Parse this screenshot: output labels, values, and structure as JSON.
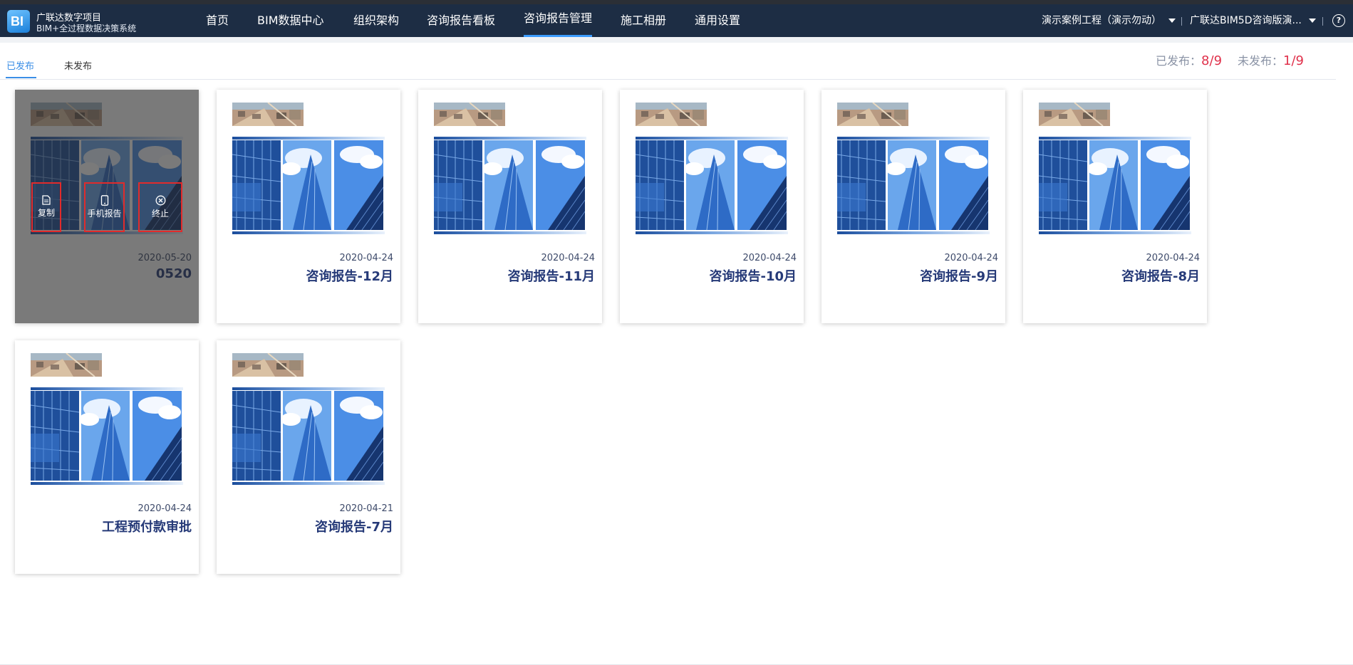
{
  "app": {
    "name": "广联达数字项目",
    "subtitle": "BIM+全过程数据决策系统"
  },
  "nav": {
    "items": [
      {
        "label": "首页"
      },
      {
        "label": "BIM数据中心"
      },
      {
        "label": "组织架构"
      },
      {
        "label": "咨询报告看板"
      },
      {
        "label": "咨询报告管理"
      },
      {
        "label": "施工相册"
      },
      {
        "label": "通用设置"
      }
    ],
    "active": "咨询报告管理",
    "project_select": "演示案例工程（演示勿动）",
    "org_select": "广联达BIM5D咨询版演...",
    "help_icon": "help-icon"
  },
  "tabs": {
    "published": "已发布",
    "unpublished": "未发布",
    "active": "已发布"
  },
  "stats": {
    "published_label": "已发布：",
    "published_value": "8/9",
    "unpublished_label": "未发布：",
    "unpublished_value": "1/9"
  },
  "hover_actions": {
    "copy": "复制",
    "mobile": "手机报告",
    "stop": "终止"
  },
  "reports": [
    {
      "date": "2020-05-20",
      "title": "0520",
      "hovered": true
    },
    {
      "date": "2020-04-24",
      "title": "咨询报告-12月"
    },
    {
      "date": "2020-04-24",
      "title": "咨询报告-11月"
    },
    {
      "date": "2020-04-24",
      "title": "咨询报告-10月"
    },
    {
      "date": "2020-04-24",
      "title": "咨询报告-9月"
    },
    {
      "date": "2020-04-24",
      "title": "咨询报告-8月"
    },
    {
      "date": "2020-04-24",
      "title": "工程预付款审批"
    },
    {
      "date": "2020-04-21",
      "title": "咨询报告-7月"
    }
  ],
  "colors": {
    "navbar": "#1d2d44",
    "accent": "#3a8ee6",
    "stat_value": "#e0314b",
    "title": "#263a78"
  }
}
